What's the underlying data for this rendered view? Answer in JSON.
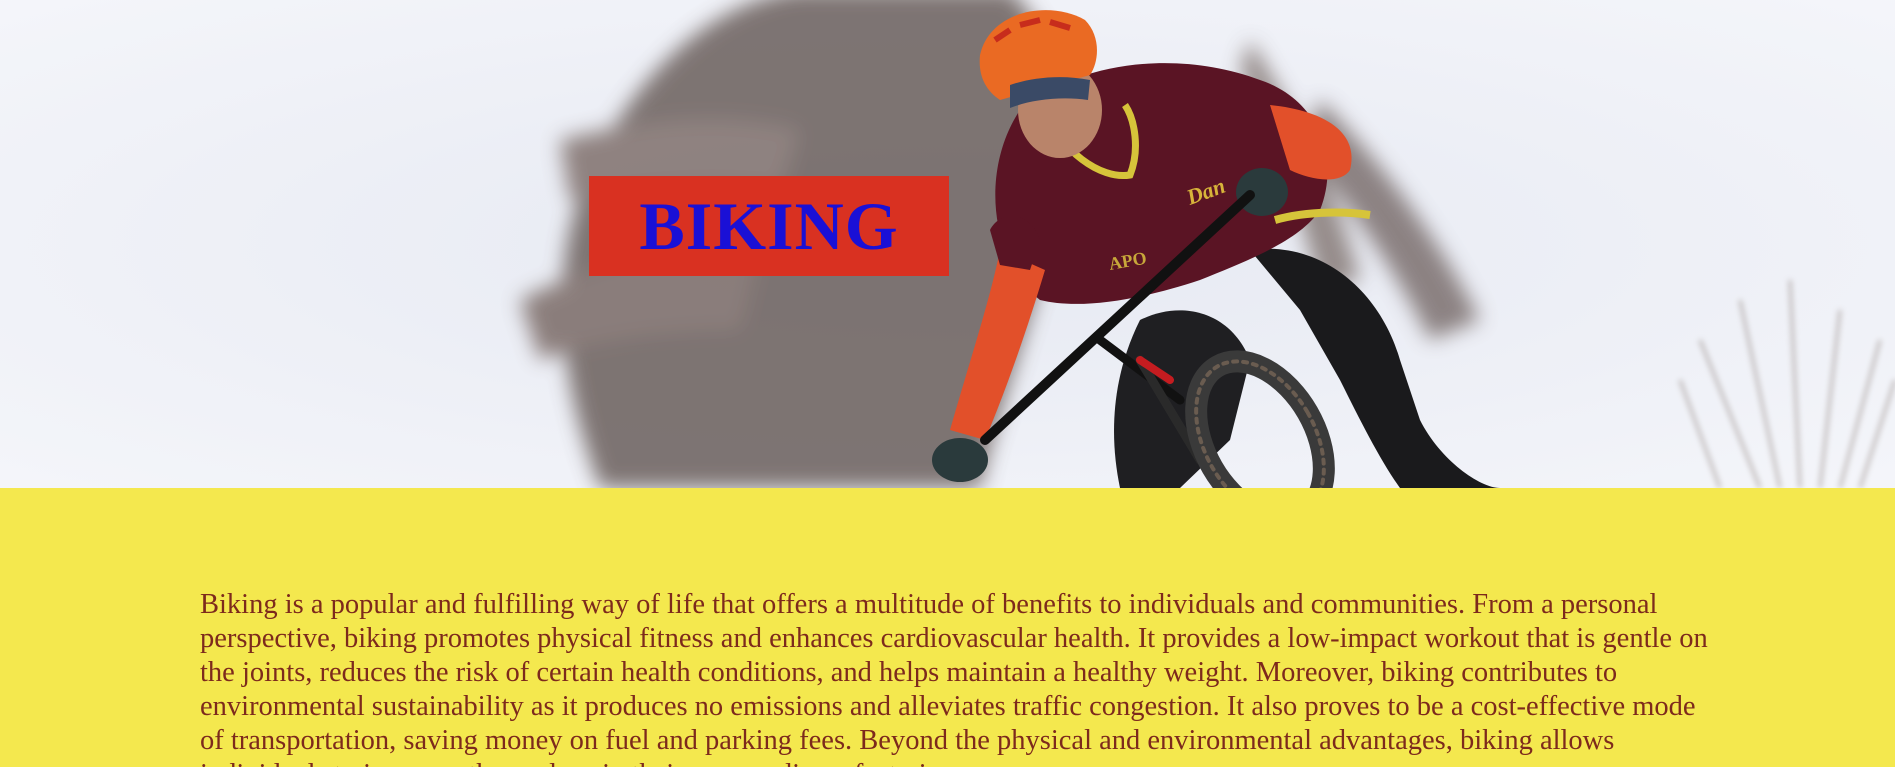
{
  "hero": {
    "title": "BIKING",
    "image_description_icon": "mountain-biker-photo"
  },
  "content": {
    "paragraph": "Biking is a popular and fulfilling way of life that offers a multitude of benefits to individuals and communities. From a personal perspective, biking promotes physical fitness and enhances cardiovascular health. It provides a low-impact workout that is gentle on the joints, reduces the risk of certain health conditions, and helps maintain a healthy weight. Moreover, biking contributes to environmental sustainability as it produces no emissions and alleviates traffic congestion. It also proves to be a cost-effective mode of transportation, saving money on fuel and parking fees. Beyond the physical and environmental advantages, biking allows individuals to immerse themselves in their surroundings, fostering a sense"
  },
  "colors": {
    "page_background": "#f4e84e",
    "title_box": "#d93121",
    "title_text": "#1a10d6",
    "body_text": "#7d2a1c"
  }
}
